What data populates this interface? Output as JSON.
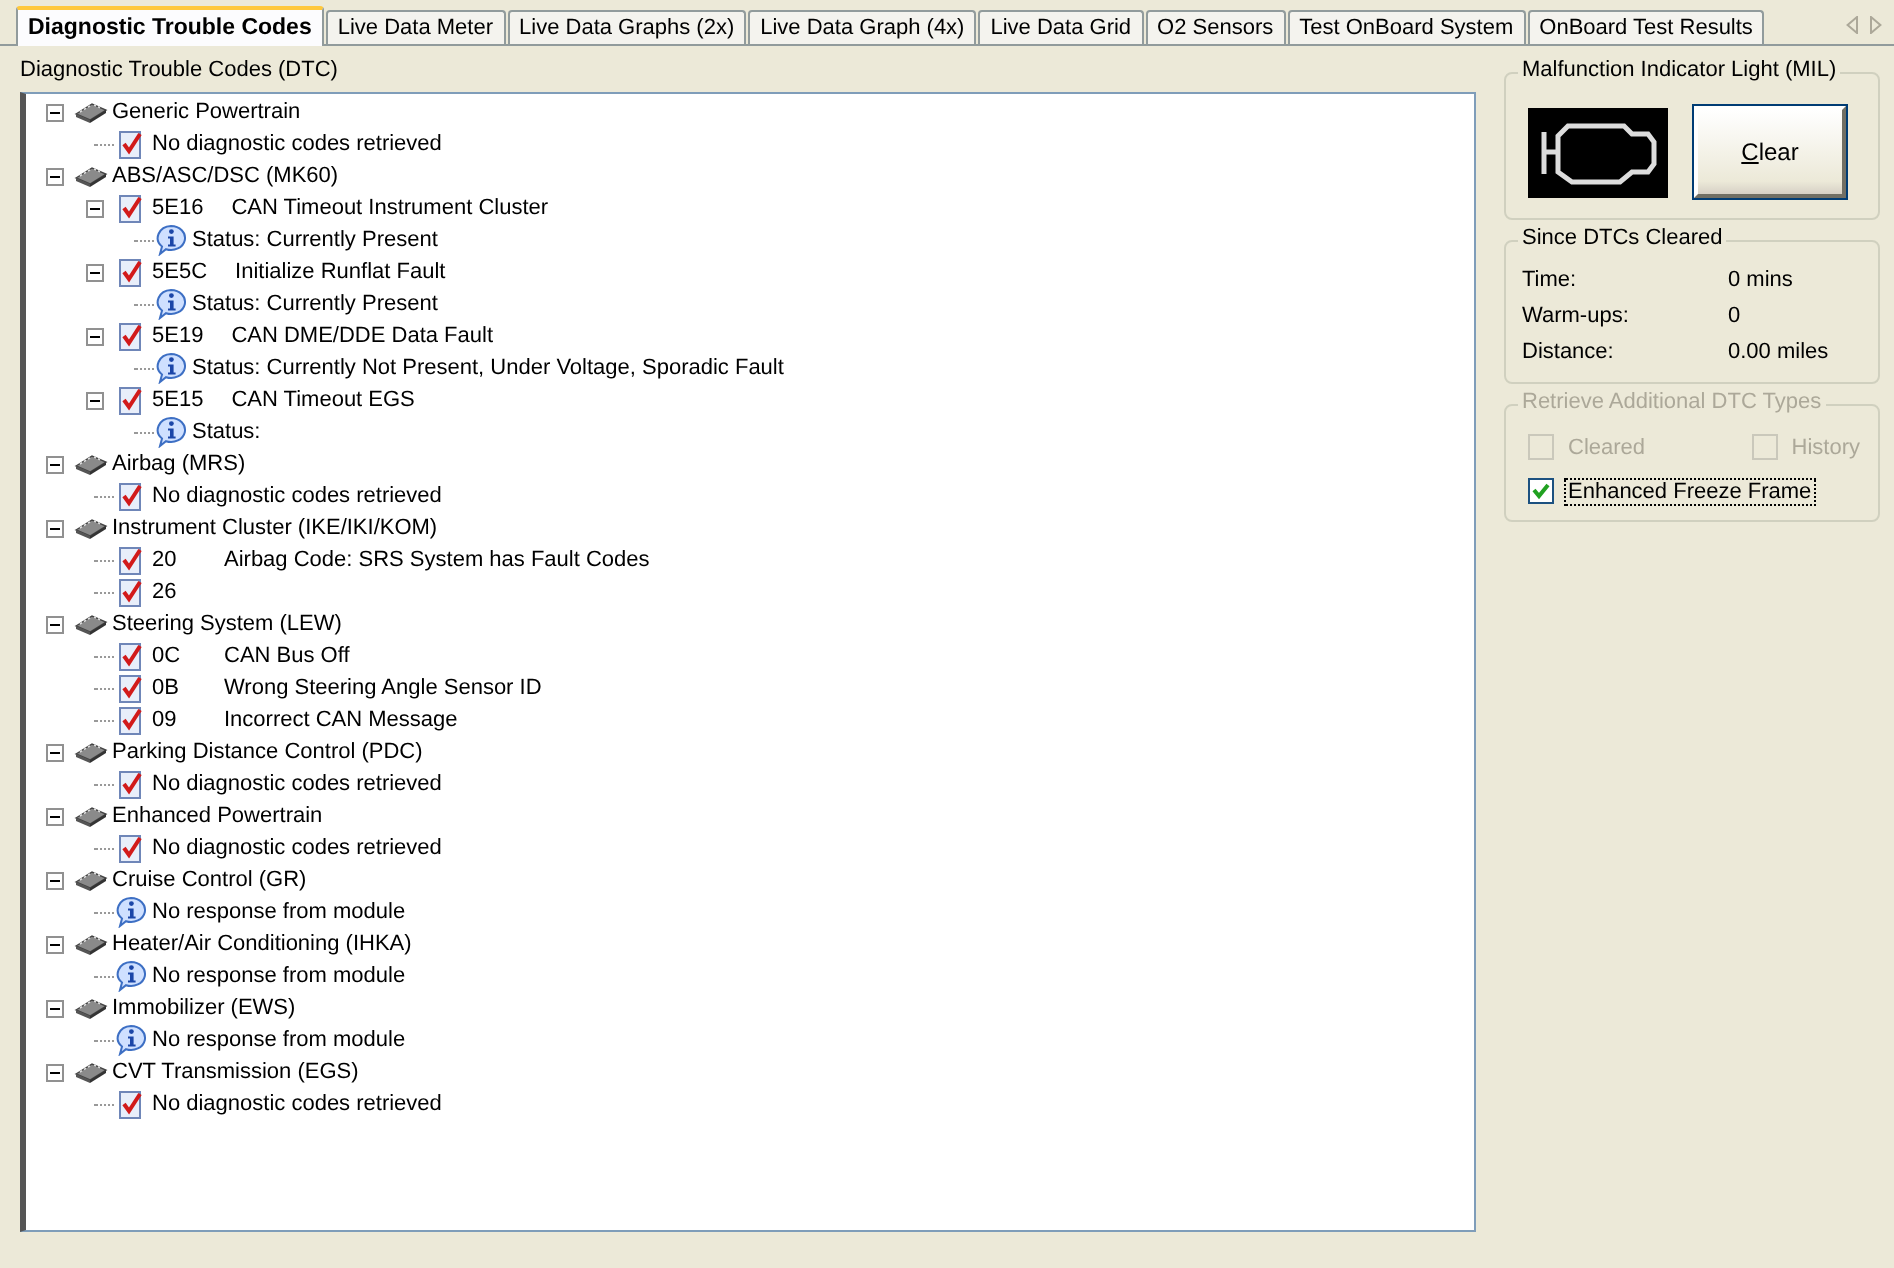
{
  "tabs": [
    {
      "label": "Diagnostic Trouble Codes",
      "selected": true
    },
    {
      "label": "Live Data Meter",
      "selected": false
    },
    {
      "label": "Live Data Graphs (2x)",
      "selected": false
    },
    {
      "label": "Live Data Graph (4x)",
      "selected": false
    },
    {
      "label": "Live Data Grid",
      "selected": false
    },
    {
      "label": "O2 Sensors",
      "selected": false
    },
    {
      "label": "Test OnBoard System",
      "selected": false
    },
    {
      "label": "OnBoard Test Results",
      "selected": false
    }
  ],
  "dtc_panel": {
    "title": "Diagnostic Trouble Codes (DTC)",
    "tree": [
      {
        "kind": "module",
        "text": "Generic Powertrain",
        "expanded": true,
        "children": [
          {
            "kind": "report",
            "text": "No diagnostic codes retrieved"
          }
        ]
      },
      {
        "kind": "module",
        "text": "ABS/ASC/DSC (MK60)",
        "expanded": true,
        "children": [
          {
            "kind": "report",
            "code": "5E16",
            "text": "CAN Timeout Instrument Cluster",
            "expanded": true,
            "children": [
              {
                "kind": "info",
                "text": "Status: Currently Present"
              }
            ]
          },
          {
            "kind": "report",
            "code": "5E5C",
            "text": "Initialize Runflat Fault",
            "expanded": true,
            "children": [
              {
                "kind": "info",
                "text": "Status: Currently Present"
              }
            ]
          },
          {
            "kind": "report",
            "code": "5E19",
            "text": "CAN DME/DDE Data Fault",
            "expanded": true,
            "children": [
              {
                "kind": "info",
                "text": "Status: Currently Not Present, Under Voltage, Sporadic Fault"
              }
            ]
          },
          {
            "kind": "report",
            "code": "5E15",
            "text": "CAN Timeout EGS",
            "expanded": true,
            "children": [
              {
                "kind": "info",
                "text": "Status:"
              }
            ]
          }
        ]
      },
      {
        "kind": "module",
        "text": "Airbag (MRS)",
        "expanded": true,
        "children": [
          {
            "kind": "report",
            "text": "No diagnostic codes retrieved"
          }
        ]
      },
      {
        "kind": "module",
        "text": "Instrument Cluster (IKE/IKI/KOM)",
        "expanded": true,
        "children": [
          {
            "kind": "report",
            "code": "20",
            "text": "Airbag Code: SRS System has Fault Codes"
          },
          {
            "kind": "report",
            "code": "26"
          }
        ]
      },
      {
        "kind": "module",
        "text": "Steering System (LEW)",
        "expanded": true,
        "children": [
          {
            "kind": "report",
            "code": "0C",
            "text": "CAN Bus Off"
          },
          {
            "kind": "report",
            "code": "0B",
            "text": "Wrong Steering Angle Sensor ID"
          },
          {
            "kind": "report",
            "code": "09",
            "text": "Incorrect CAN Message"
          }
        ]
      },
      {
        "kind": "module",
        "text": "Parking Distance Control (PDC)",
        "expanded": true,
        "children": [
          {
            "kind": "report",
            "text": "No diagnostic codes retrieved"
          }
        ]
      },
      {
        "kind": "module",
        "text": "Enhanced Powertrain",
        "expanded": true,
        "children": [
          {
            "kind": "report",
            "text": "No diagnostic codes retrieved"
          }
        ]
      },
      {
        "kind": "module",
        "text": "Cruise Control (GR)",
        "expanded": true,
        "children": [
          {
            "kind": "info",
            "text": "No response from module"
          }
        ]
      },
      {
        "kind": "module",
        "text": "Heater/Air Conditioning (IHKA)",
        "expanded": true,
        "children": [
          {
            "kind": "info",
            "text": "No response from module"
          }
        ]
      },
      {
        "kind": "module",
        "text": "Immobilizer (EWS)",
        "expanded": true,
        "children": [
          {
            "kind": "info",
            "text": "No response from module"
          }
        ]
      },
      {
        "kind": "module",
        "text": "CVT Transmission (EGS)",
        "expanded": true,
        "children": [
          {
            "kind": "report",
            "text": "No diagnostic codes retrieved"
          }
        ]
      }
    ]
  },
  "mil": {
    "title": "Malfunction Indicator Light (MIL)",
    "button": "Clear"
  },
  "since_cleared": {
    "title": "Since DTCs Cleared",
    "rows": [
      {
        "label": "Time:",
        "value": "0 mins"
      },
      {
        "label": "Warm-ups:",
        "value": "0"
      },
      {
        "label": "Distance:",
        "value": "0.00 miles"
      }
    ]
  },
  "additional_types": {
    "title": "Retrieve Additional DTC Types",
    "disabled": true,
    "options": [
      {
        "label": "Cleared",
        "checked": false,
        "disabled": true
      },
      {
        "label": "History",
        "checked": false,
        "disabled": true
      },
      {
        "label": "Enhanced Freeze Frame",
        "checked": true,
        "disabled": false
      }
    ]
  }
}
